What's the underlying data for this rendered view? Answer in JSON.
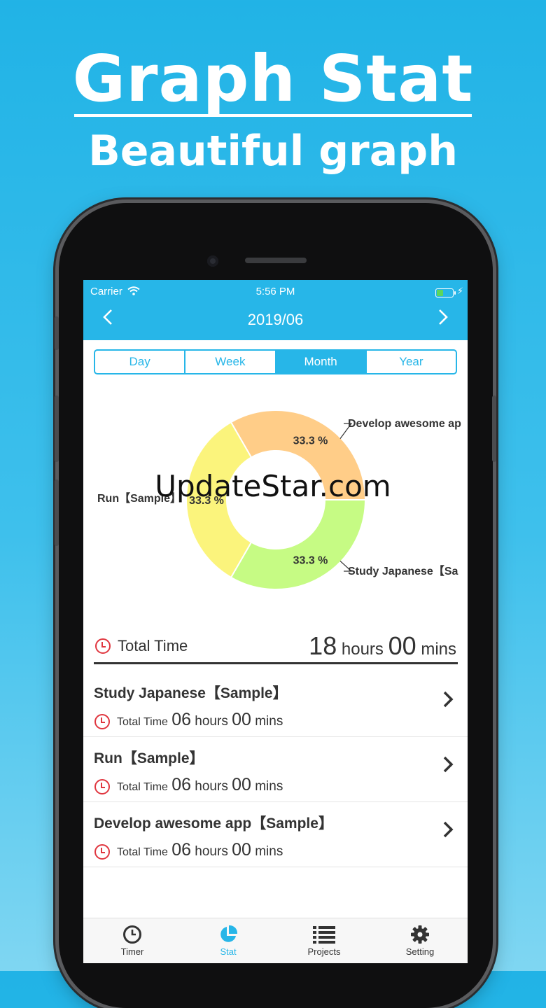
{
  "promo": {
    "title": "Graph Stat",
    "subtitle": "Beautiful graph"
  },
  "status_bar": {
    "carrier": "Carrier",
    "time": "5:56 PM"
  },
  "nav": {
    "title": "2019/06",
    "prev": "<",
    "next": ">"
  },
  "segments": [
    {
      "label": "Day",
      "active": false
    },
    {
      "label": "Week",
      "active": false
    },
    {
      "label": "Month",
      "active": true
    },
    {
      "label": "Year",
      "active": false
    }
  ],
  "chart_data": {
    "type": "pie",
    "donut": true,
    "slices": [
      {
        "name": "Develop awesome ap",
        "value": 33.3,
        "label": "33.3 %",
        "color": "#ffcd88"
      },
      {
        "name": "Study Japanese【Sa",
        "value": 33.3,
        "label": "33.3 %",
        "color": "#c6fb84"
      },
      {
        "name": "Run【Sample】",
        "value": 33.3,
        "label": "33.3 %",
        "color": "#fbf47c"
      }
    ]
  },
  "total": {
    "label": "Total Time",
    "hours": "18",
    "hours_unit": "hours",
    "mins": "00",
    "mins_unit": "mins"
  },
  "projects": [
    {
      "name": "Study Japanese【Sample】",
      "time_label": "Total Time",
      "hours": "06",
      "hours_unit": "hours",
      "mins": "00",
      "mins_unit": "mins"
    },
    {
      "name": "Run【Sample】",
      "time_label": "Total Time",
      "hours": "06",
      "hours_unit": "hours",
      "mins": "00",
      "mins_unit": "mins"
    },
    {
      "name": "Develop awesome app【Sample】",
      "time_label": "Total Time",
      "hours": "06",
      "hours_unit": "hours",
      "mins": "00",
      "mins_unit": "mins"
    }
  ],
  "tabs": [
    {
      "label": "Timer",
      "icon": "clock-icon",
      "active": false
    },
    {
      "label": "Stat",
      "icon": "pie-chart-icon",
      "active": true
    },
    {
      "label": "Projects",
      "icon": "list-icon",
      "active": false
    },
    {
      "label": "Setting",
      "icon": "gear-icon",
      "active": false
    }
  ],
  "watermark": "UpdateStar.com",
  "colors": {
    "accent": "#27b6e8",
    "clock": "#e0363f"
  }
}
